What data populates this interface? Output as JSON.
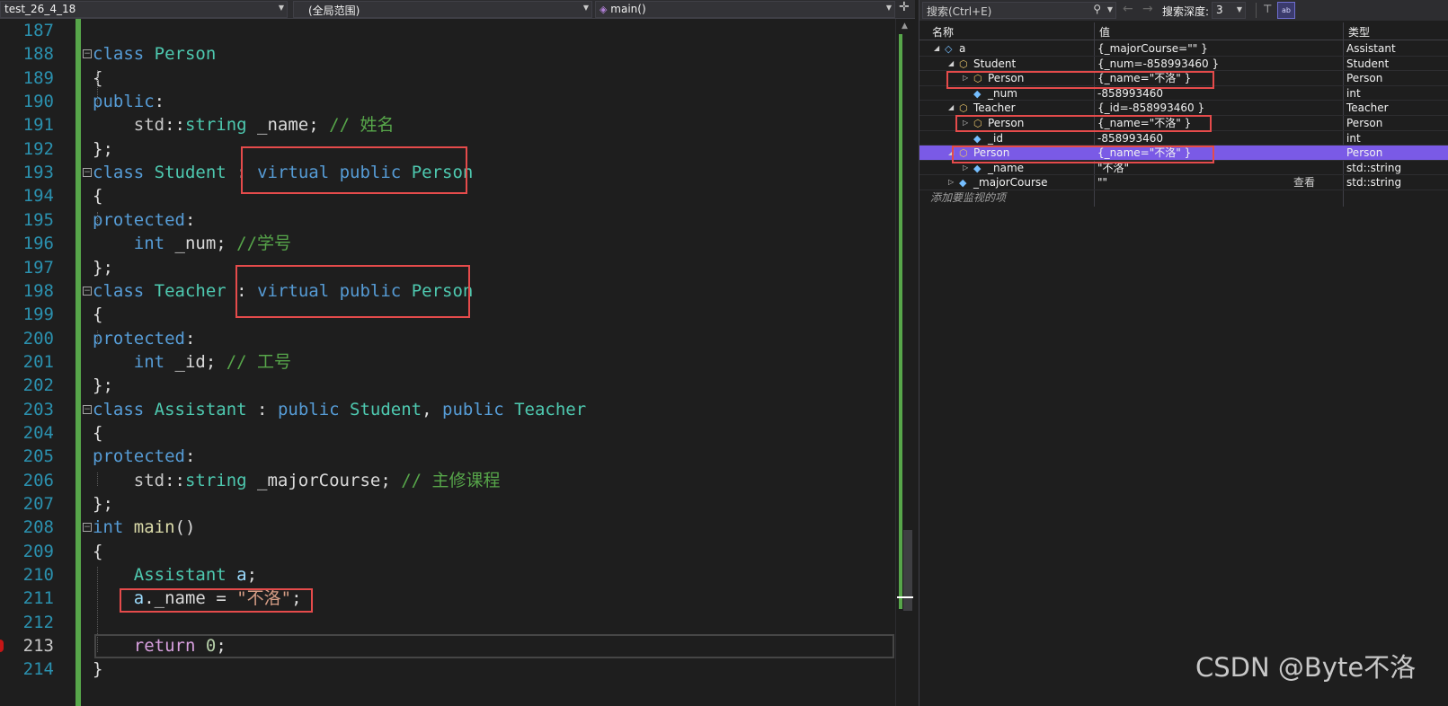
{
  "nav": {
    "project": "test_26_4_18",
    "scope": "(全局范围)",
    "function": "main()",
    "split_icon": "plus-sign"
  },
  "code": {
    "line_numbers": [
      "187",
      "188",
      "189",
      "190",
      "191",
      "192",
      "193",
      "194",
      "195",
      "196",
      "197",
      "198",
      "199",
      "200",
      "201",
      "202",
      "203",
      "204",
      "205",
      "206",
      "207",
      "208",
      "209",
      "210",
      "211",
      "212",
      "213",
      "214"
    ],
    "current_line": "213",
    "lines": [
      {
        "n": "187",
        "tokens": []
      },
      {
        "n": "188",
        "tokens": [
          {
            "t": "class",
            "c": "kw"
          },
          {
            "t": " ",
            "c": ""
          },
          {
            "t": "Person",
            "c": "ty"
          }
        ]
      },
      {
        "n": "189",
        "tokens": [
          {
            "t": "{",
            "c": ""
          }
        ]
      },
      {
        "n": "190",
        "tokens": [
          {
            "t": "public",
            "c": "kw"
          },
          {
            "t": ":",
            "c": ""
          }
        ]
      },
      {
        "n": "191",
        "tokens": [
          {
            "t": "    std",
            "c": "ns"
          },
          {
            "t": "::",
            "c": ""
          },
          {
            "t": "string",
            "c": "ty"
          },
          {
            "t": " _name; ",
            "c": "mb"
          },
          {
            "t": "// 姓名",
            "c": "cm"
          }
        ]
      },
      {
        "n": "192",
        "tokens": [
          {
            "t": "};",
            "c": ""
          }
        ]
      },
      {
        "n": "193",
        "tokens": [
          {
            "t": "class",
            "c": "kw"
          },
          {
            "t": " ",
            "c": ""
          },
          {
            "t": "Student",
            "c": "ty"
          },
          {
            "t": " : ",
            "c": ""
          },
          {
            "t": "virtual",
            "c": "kw"
          },
          {
            "t": " ",
            "c": ""
          },
          {
            "t": "public",
            "c": "kw"
          },
          {
            "t": " ",
            "c": ""
          },
          {
            "t": "Person",
            "c": "ty"
          }
        ]
      },
      {
        "n": "194",
        "tokens": [
          {
            "t": "{",
            "c": ""
          }
        ]
      },
      {
        "n": "195",
        "tokens": [
          {
            "t": "protected",
            "c": "kw"
          },
          {
            "t": ":",
            "c": ""
          }
        ]
      },
      {
        "n": "196",
        "tokens": [
          {
            "t": "    ",
            "c": ""
          },
          {
            "t": "int",
            "c": "kw"
          },
          {
            "t": " _num; ",
            "c": "mb"
          },
          {
            "t": "//学号",
            "c": "cm"
          }
        ]
      },
      {
        "n": "197",
        "tokens": [
          {
            "t": "};",
            "c": ""
          }
        ]
      },
      {
        "n": "198",
        "tokens": [
          {
            "t": "class",
            "c": "kw"
          },
          {
            "t": " ",
            "c": ""
          },
          {
            "t": "Teacher",
            "c": "ty"
          },
          {
            "t": " : ",
            "c": ""
          },
          {
            "t": "virtual",
            "c": "kw"
          },
          {
            "t": " ",
            "c": ""
          },
          {
            "t": "public",
            "c": "kw"
          },
          {
            "t": " ",
            "c": ""
          },
          {
            "t": "Person",
            "c": "ty"
          }
        ]
      },
      {
        "n": "199",
        "tokens": [
          {
            "t": "{",
            "c": ""
          }
        ]
      },
      {
        "n": "200",
        "tokens": [
          {
            "t": "protected",
            "c": "kw"
          },
          {
            "t": ":",
            "c": ""
          }
        ]
      },
      {
        "n": "201",
        "tokens": [
          {
            "t": "    ",
            "c": ""
          },
          {
            "t": "int",
            "c": "kw"
          },
          {
            "t": " _id; ",
            "c": "mb"
          },
          {
            "t": "// 工号",
            "c": "cm"
          }
        ]
      },
      {
        "n": "202",
        "tokens": [
          {
            "t": "};",
            "c": ""
          }
        ]
      },
      {
        "n": "203",
        "tokens": [
          {
            "t": "class",
            "c": "kw"
          },
          {
            "t": " ",
            "c": ""
          },
          {
            "t": "Assistant",
            "c": "ty"
          },
          {
            "t": " : ",
            "c": ""
          },
          {
            "t": "public",
            "c": "kw"
          },
          {
            "t": " ",
            "c": ""
          },
          {
            "t": "Student",
            "c": "ty"
          },
          {
            "t": ", ",
            "c": ""
          },
          {
            "t": "public",
            "c": "kw"
          },
          {
            "t": " ",
            "c": ""
          },
          {
            "t": "Teacher",
            "c": "ty"
          }
        ]
      },
      {
        "n": "204",
        "tokens": [
          {
            "t": "{",
            "c": ""
          }
        ]
      },
      {
        "n": "205",
        "tokens": [
          {
            "t": "protected",
            "c": "kw"
          },
          {
            "t": ":",
            "c": ""
          }
        ]
      },
      {
        "n": "206",
        "tokens": [
          {
            "t": "    std",
            "c": "ns"
          },
          {
            "t": "::",
            "c": ""
          },
          {
            "t": "string",
            "c": "ty"
          },
          {
            "t": " _majorCourse; ",
            "c": "mb"
          },
          {
            "t": "// 主修课程",
            "c": "cm"
          }
        ]
      },
      {
        "n": "207",
        "tokens": [
          {
            "t": "};",
            "c": ""
          }
        ]
      },
      {
        "n": "208",
        "tokens": [
          {
            "t": "int",
            "c": "kw"
          },
          {
            "t": " ",
            "c": ""
          },
          {
            "t": "main",
            "c": "fn"
          },
          {
            "t": "()",
            "c": ""
          }
        ]
      },
      {
        "n": "209",
        "tokens": [
          {
            "t": "{",
            "c": ""
          }
        ]
      },
      {
        "n": "210",
        "tokens": [
          {
            "t": "    ",
            "c": ""
          },
          {
            "t": "Assistant",
            "c": "ty"
          },
          {
            "t": " ",
            "c": ""
          },
          {
            "t": "a",
            "c": "var"
          },
          {
            "t": ";",
            "c": ""
          }
        ]
      },
      {
        "n": "211",
        "tokens": [
          {
            "t": "    ",
            "c": ""
          },
          {
            "t": "a",
            "c": "var"
          },
          {
            "t": ".",
            "c": ""
          },
          {
            "t": "_name",
            "c": "mb"
          },
          {
            "t": " = ",
            "c": ""
          },
          {
            "t": "\"不洛\"",
            "c": "st"
          },
          {
            "t": ";",
            "c": ""
          }
        ]
      },
      {
        "n": "212",
        "tokens": []
      },
      {
        "n": "213",
        "tokens": [
          {
            "t": "    ",
            "c": ""
          },
          {
            "t": "return",
            "c": "ct"
          },
          {
            "t": " ",
            "c": ""
          },
          {
            "t": "0",
            "c": "nu"
          },
          {
            "t": ";",
            "c": ""
          }
        ]
      },
      {
        "n": "214",
        "tokens": [
          {
            "t": "}",
            "c": ""
          }
        ]
      }
    ]
  },
  "watch": {
    "search_placeholder": "搜索(Ctrl+E)",
    "depth_label": "搜索深度:",
    "depth_value": "3",
    "hex_button": "ab",
    "columns": {
      "name": "名称",
      "value": "值",
      "type": "类型"
    },
    "rows": [
      {
        "name": "a",
        "value": "{_majorCourse=\"\" }",
        "type": "Assistant",
        "expander": "◢",
        "level": 0,
        "icon": "object-icon"
      },
      {
        "name": "Student",
        "value": "{_num=-858993460 }",
        "type": "Student",
        "expander": "◢",
        "level": 1,
        "icon": "base-class-icon"
      },
      {
        "name": "Person",
        "value": "{_name=\"不洛\" }",
        "type": "Person",
        "expander": "▷",
        "level": 2,
        "icon": "base-class-icon"
      },
      {
        "name": "_num",
        "value": "-858993460",
        "type": "int",
        "expander": "",
        "level": 2,
        "icon": "field-icon"
      },
      {
        "name": "Teacher",
        "value": "{_id=-858993460 }",
        "type": "Teacher",
        "expander": "◢",
        "level": 1,
        "icon": "base-class-icon"
      },
      {
        "name": "Person",
        "value": "{_name=\"不洛\" }",
        "type": "Person",
        "expander": "▷",
        "level": 2,
        "icon": "base-class-icon"
      },
      {
        "name": "_id",
        "value": "-858993460",
        "type": "int",
        "expander": "",
        "level": 2,
        "icon": "field-icon"
      },
      {
        "name": "Person",
        "value": "{_name=\"不洛\" }",
        "type": "Person",
        "expander": "◢",
        "level": 1,
        "icon": "base-class-icon",
        "selected": true
      },
      {
        "name": "_name",
        "value": "\"不洛\"",
        "type": "std::string",
        "expander": "▷",
        "level": 2,
        "icon": "field-icon"
      },
      {
        "name": "_majorCourse",
        "value": "\"\"",
        "type": "std::string",
        "expander": "▷",
        "level": 1,
        "icon": "field-icon",
        "view": "查看"
      }
    ],
    "add_item": "添加要监视的项"
  },
  "watermark": "CSDN @Byte不洛",
  "colors": {
    "highlight_box": "#e54b4b",
    "selection": "#7a5ae6",
    "change_bar": "#57a64a"
  }
}
